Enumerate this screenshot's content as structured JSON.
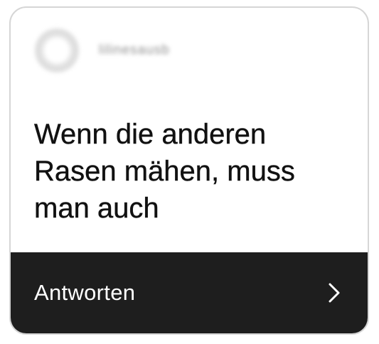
{
  "sender": {
    "avatar_icon": "blurred-avatar-icon",
    "username": "lilinesausb"
  },
  "message": {
    "text": "Wenn die anderen Rasen mähen, muss man auch"
  },
  "reply": {
    "label": "Antworten",
    "icon": "chevron-right-icon"
  },
  "colors": {
    "bar_background": "#1e1e1e",
    "bar_text": "#ffffff",
    "message_text": "#111111",
    "card_border": "#d6d6d6"
  }
}
